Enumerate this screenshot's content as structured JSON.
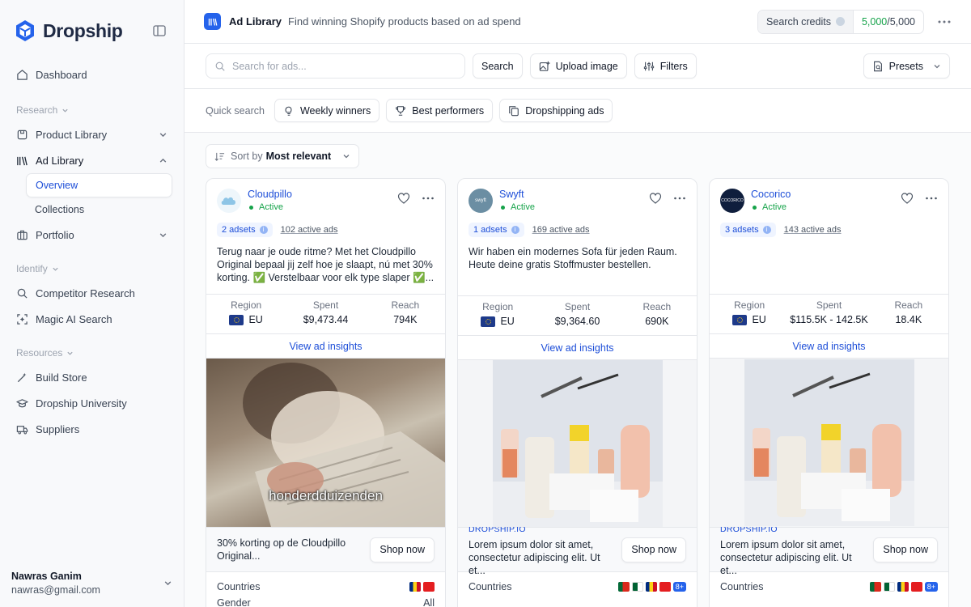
{
  "sidebar": {
    "brand": "Dropship",
    "nav": {
      "dashboard": "Dashboard",
      "research_label": "Research",
      "product_library": "Product Library",
      "ad_library": "Ad Library",
      "overview": "Overview",
      "collections": "Collections",
      "portfolio": "Portfolio",
      "identify_label": "Identify",
      "competitor_research": "Competitor Research",
      "magic_ai_search": "Magic AI Search",
      "resources_label": "Resources",
      "build_store": "Build Store",
      "dropship_university": "Dropship University",
      "suppliers": "Suppliers"
    },
    "user": {
      "name": "Nawras Ganim",
      "email": "nawras@gmail.com"
    }
  },
  "header": {
    "title": "Ad Library",
    "subtitle": "Find winning Shopify products based on ad spend",
    "credits_label": "Search credits",
    "credits_used": "5,000",
    "credits_total": "/5,000"
  },
  "search": {
    "placeholder": "Search for ads...",
    "search_button": "Search",
    "upload_button": "Upload image",
    "filters_button": "Filters",
    "presets_button": "Presets"
  },
  "quick": {
    "label": "Quick search",
    "weekly": "Weekly winners",
    "best": "Best performers",
    "dropshipping": "Dropshipping ads"
  },
  "sort": {
    "prefix": "Sort by",
    "value": "Most relevant"
  },
  "labels": {
    "region": "Region",
    "spent": "Spent",
    "reach": "Reach",
    "insights": "View ad insights",
    "shop": "Shop now",
    "countries": "Countries",
    "gender": "Gender"
  },
  "cards": [
    {
      "brand": "Cloudpillo",
      "status": "Active",
      "adsets": "2 adsets",
      "active_ads": "102 active ads",
      "copy": "Terug naar je oude ritme? Met het Cloudpillo Original bepaal jij zelf hoe je slaapt, nú met 30% korting. ✅ Verstelbaar voor elk type slaper ✅...",
      "region": "EU",
      "spent": "$9,473.44",
      "reach": "794K",
      "caption": "honderdduizenden",
      "cta_domain": "",
      "cta_text": "30% korting op de Cloudpillo Original...",
      "gender": "All"
    },
    {
      "brand": "Swyft",
      "status": "Active",
      "adsets": "1 adsets",
      "active_ads": "169 active ads",
      "copy": "Wir haben ein modernes Sofa für jeden Raum. Heute deine gratis Stoffmuster bestellen.",
      "region": "EU",
      "spent": "$9,364.60",
      "reach": "690K",
      "cta_domain": "DROPSHIP.IO",
      "cta_text": "Lorem ipsum dolor sit amet, consectetur adipiscing elit. Ut et...",
      "more": "8+"
    },
    {
      "brand": "Cocorico",
      "status": "Active",
      "adsets": "3 adsets",
      "active_ads": "143 active ads",
      "copy": "",
      "region": "EU",
      "spent": "$115.5K - 142.5K",
      "reach": "18.4K",
      "cta_domain": "DROPSHIP.IO",
      "cta_text": "Lorem ipsum dolor sit amet, consectetur adipiscing elit. Ut et...",
      "more": "8+"
    }
  ],
  "colors": {
    "accent": "#2563eb",
    "active": "#16a34a",
    "brand_dark": "#1f2a44"
  }
}
